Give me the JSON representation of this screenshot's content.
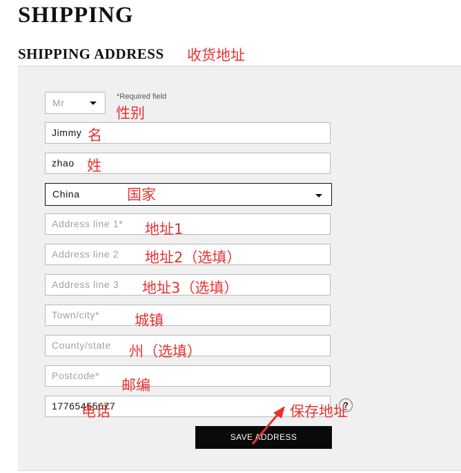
{
  "header": {
    "page_title": "SHIPPING",
    "section_title": "SHIPPING ADDRESS"
  },
  "form": {
    "title_select": {
      "value": "Mr"
    },
    "required_note": "*Required field",
    "first_name": {
      "value": "Jimmy"
    },
    "last_name": {
      "value": "zhao"
    },
    "country": {
      "value": "China"
    },
    "address_line_1": {
      "placeholder": "Address line 1*"
    },
    "address_line_2": {
      "placeholder": "Address line 2"
    },
    "address_line_3": {
      "placeholder": "Address line 3"
    },
    "town_city": {
      "placeholder": "Town/city*"
    },
    "county_state": {
      "placeholder": "County/state"
    },
    "postcode": {
      "placeholder": "Postcode*"
    },
    "phone": {
      "value": "17765455677"
    },
    "help_icon": "?",
    "save_button": "SAVE ADDRESS"
  },
  "annotations": {
    "shipping_address": "收货地址",
    "title": "性别",
    "first_name": "名",
    "last_name": "姓",
    "country": "国家",
    "address_1": "地址1",
    "address_2": "地址2（选填）",
    "address_3": "地址3（选填）",
    "town_city": "城镇",
    "county_state": "州（选填）",
    "postcode": "邮编",
    "phone": "电话",
    "save": "保存地址"
  },
  "colors": {
    "annotation": "#e8312f",
    "button_background": "#0a0a0a",
    "panel_background": "#f0f0f0"
  }
}
